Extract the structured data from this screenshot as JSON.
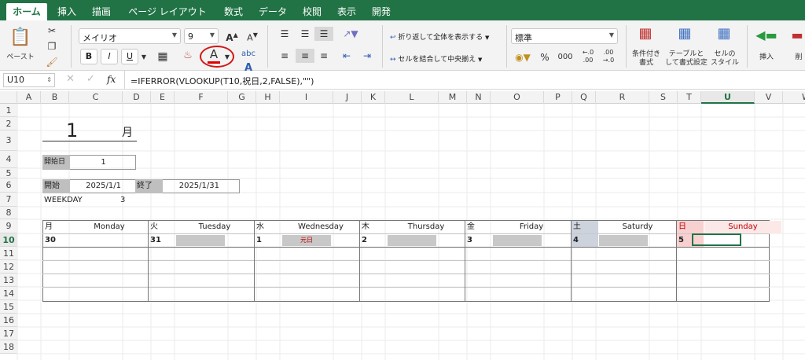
{
  "tabs": [
    {
      "label": "ホーム",
      "active": true
    },
    {
      "label": "挿入"
    },
    {
      "label": "描画"
    },
    {
      "label": "ページ レイアウト"
    },
    {
      "label": "数式"
    },
    {
      "label": "データ"
    },
    {
      "label": "校閲"
    },
    {
      "label": "表示"
    },
    {
      "label": "開発"
    }
  ],
  "ribbon": {
    "paste_label": "ペースト",
    "font_name": "メイリオ",
    "font_size": "9",
    "bold": "B",
    "italic": "I",
    "underline": "U",
    "font_color_letter": "A",
    "wrap_text_label": "折り返して全体を表示する",
    "merge_center_label": "セルを結合して中央揃え",
    "number_format": "標準",
    "percent": "%",
    "comma": "000",
    "cond_format_label": [
      "条件付き",
      "書式"
    ],
    "table_format_label": [
      "テーブルと",
      "して書式設定"
    ],
    "cell_style_label": [
      "セルの",
      "スタイル"
    ],
    "insert_label": "挿入",
    "delete_label": "削"
  },
  "formula_bar": {
    "name_box": "U10",
    "fx": "fx",
    "formula": "=IFERROR(VLOOKUP(T10,祝日,2,FALSE),\"\")"
  },
  "columns": [
    "A",
    "B",
    "C",
    "D",
    "E",
    "F",
    "G",
    "H",
    "I",
    "J",
    "K",
    "L",
    "M",
    "N",
    "O",
    "P",
    "Q",
    "R",
    "S",
    "T",
    "U",
    "V",
    "W"
  ],
  "rows": [
    "1",
    "2",
    "3",
    "4",
    "5",
    "6",
    "7",
    "8",
    "9",
    "10",
    "11",
    "12",
    "13",
    "14",
    "15",
    "16",
    "17",
    "18"
  ],
  "sheet": {
    "month_number": "1",
    "month_suffix": "月",
    "start_day_label": "開始日",
    "start_day_value": "1",
    "start_label": "開始",
    "start_date": "2025/1/1",
    "end_label": "終了",
    "end_date": "2025/1/31",
    "weekday_label": "WEEKDAY",
    "weekday_value": "3",
    "days": [
      {
        "kanji": "月",
        "name": "Monday",
        "date": "30",
        "holiday": ""
      },
      {
        "kanji": "火",
        "name": "Tuesday",
        "date": "31",
        "holiday": ""
      },
      {
        "kanji": "水",
        "name": "Wednesday",
        "date": "1",
        "holiday": "元日"
      },
      {
        "kanji": "木",
        "name": "Thursday",
        "date": "2",
        "holiday": ""
      },
      {
        "kanji": "金",
        "name": "Friday",
        "date": "3",
        "holiday": ""
      },
      {
        "kanji": "土",
        "name": "Saturdy",
        "date": "4",
        "holiday": ""
      },
      {
        "kanji": "日",
        "name": "Sunday",
        "date": "5",
        "holiday": ""
      }
    ]
  },
  "colors": {
    "accent": "#217346",
    "sunday_red": "#c00000",
    "saturday_fill": "#cdd3dc",
    "sunday_fill": "#f8d0d0",
    "holiday_fill": "#c8c8c8",
    "font_color_underline": "#e00000"
  }
}
